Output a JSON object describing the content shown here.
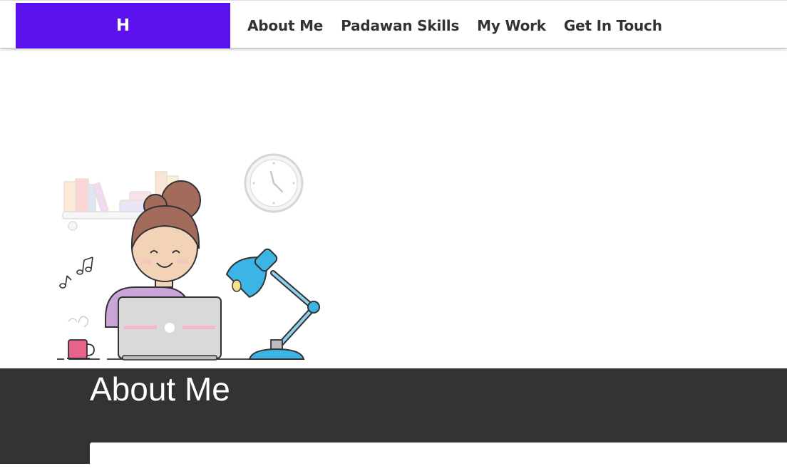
{
  "brand": {
    "label": "H",
    "color": "#5b12ee"
  },
  "nav": {
    "links": [
      {
        "label": "About Me"
      },
      {
        "label": "Padawan Skills"
      },
      {
        "label": "My Work"
      },
      {
        "label": "Get In Touch"
      }
    ]
  },
  "hero": {
    "illustration": "woman-working-at-laptop-illustration"
  },
  "about": {
    "title": "About Me",
    "background": "#333333"
  }
}
